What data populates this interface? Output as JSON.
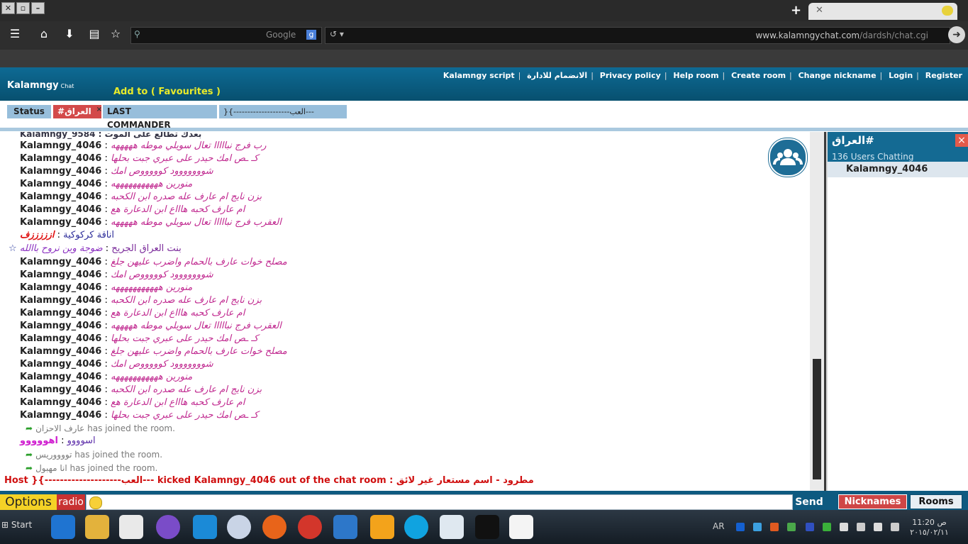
{
  "browser": {
    "search_engine": "Google",
    "url_host": "www.kalamngychat.com",
    "url_path": "/dardsh/chat.cgi"
  },
  "site": {
    "logo": "Kalamngy",
    "logo_sub": "Chat",
    "add_to": "Add to",
    "favourites": "( Favourites )",
    "menu": [
      "Kalamngy script",
      "الانضمام للادارة",
      "Privacy policy",
      "Help room",
      "Create room",
      "Change nickname",
      "Login",
      "Register"
    ]
  },
  "tabs": {
    "status": "Status",
    "active_room": "#العراق",
    "close": "×",
    "tab3": "LAST COMMANDER____",
    "tab4": "}{--------------------العب---"
  },
  "chat": {
    "clipped_top": "Kalamngy_9584 : بعدك تطالع على الموت",
    "lines": [
      {
        "nick": "Kalamngy_4046",
        "text": "رب فرج نبااااا تعال سويلي موطه هههههه"
      },
      {
        "nick": "Kalamngy_4046",
        "text": "كـ ـص  امك حيدر على عبري  جبت بحلها"
      },
      {
        "nick": "Kalamngy_4046",
        "text": "شووووووود كوووووص  امك"
      },
      {
        "nick": "Kalamngy_4046",
        "text": "منورين هههههههههههه"
      },
      {
        "nick": "Kalamngy_4046",
        "text": "بزن نايج ام عارف عله صدره ابن الكحبه"
      },
      {
        "nick": "Kalamngy_4046",
        "text": "ام عارف كحبه هاااع ابن الدعارة هع"
      },
      {
        "nick": "Kalamngy_4046",
        "text": "العقرب فرج نبااااا تعال سويلي موطه هههههه"
      }
    ],
    "special1_text": "ازززززف",
    "special1_nick": "اناقة كركوكية",
    "special2_nick": "بنت العراق الجريح",
    "special2_text": "ضوجة وين نروح باالله",
    "lines2": [
      {
        "nick": "Kalamngy_4046",
        "text": "مصلح خوات عارف بالحمام واضرب عليهن جلغ"
      },
      {
        "nick": "Kalamngy_4046",
        "text": "شووووووود كوووووص  امك"
      },
      {
        "nick": "Kalamngy_4046",
        "text": "منورين هههههههههههه"
      },
      {
        "nick": "Kalamngy_4046",
        "text": "بزن نايج ام عارف عله صدره ابن الكحبه"
      },
      {
        "nick": "Kalamngy_4046",
        "text": "ام عارف كحبه هاااع ابن الدعارة هع"
      },
      {
        "nick": "Kalamngy_4046",
        "text": "العقرب فرج نبااااا تعال سويلي موطه هههههه"
      },
      {
        "nick": "Kalamngy_4046",
        "text": "كـ ـص  امك حيدر على عبري  جبت بحلها"
      },
      {
        "nick": "Kalamngy_4046",
        "text": "مصلح خوات عارف بالحمام واضرب عليهن جلغ"
      },
      {
        "nick": "Kalamngy_4046",
        "text": "شووووووود كوووووص  امك"
      },
      {
        "nick": "Kalamngy_4046",
        "text": "منورين هههههههههههه"
      },
      {
        "nick": "Kalamngy_4046",
        "text": "بزن نايج ام عارف عله صدره ابن الكحبه"
      },
      {
        "nick": "Kalamngy_4046",
        "text": "ام عارف كحبه هاااع ابن الدعارة هع"
      },
      {
        "nick": "Kalamngy_4046",
        "text": "كـ ـص  امك حيدر على عبري  جبت بحلها"
      }
    ],
    "join1": "عارف الاحزان has joined the room.",
    "user_asw": "اسوووو",
    "user_asw_text": "اهووووو",
    "join2": "تووووريس has joined the room.",
    "join3": "انا مهبول has joined the room.",
    "kick_host": "Host",
    "kick_text": "}{--------------------العب--- kicked Kalamngy_4046 out of the chat room : مطرود - اسم مستعار غير لائق"
  },
  "sidebar": {
    "room": "العراق#",
    "count": "136 Users Chatting",
    "user": "Kalamngy_4046",
    "close": "×"
  },
  "inputbar": {
    "options": "Options",
    "radio": "radio",
    "send": "Send",
    "nicknames": "Nicknames",
    "rooms": "Rooms"
  },
  "taskbar": {
    "start": "Start",
    "lang": "AR",
    "time": "11:20 ص",
    "date": "٢٠١٥/٠٢/١١"
  },
  "colors": {
    "header": "#0e6a94",
    "message": "#c0288f",
    "kick": "#d01010",
    "active_tab": "#d34a4a"
  }
}
